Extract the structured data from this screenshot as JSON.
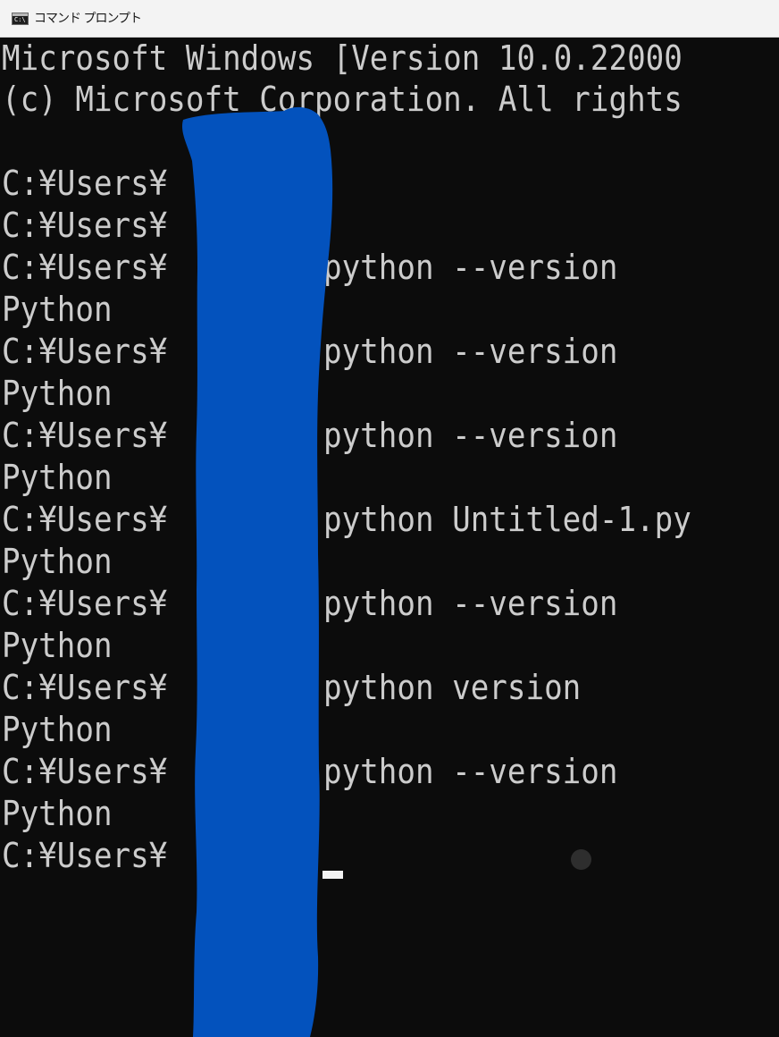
{
  "window": {
    "title": "コマンド プロンプト",
    "icon": "command-prompt-icon",
    "icon_glyph": "C:\\"
  },
  "console": {
    "banner": [
      "Microsoft Windows [Version 10.0.22000",
      "(c) Microsoft Corporation. All rights"
    ],
    "history": [
      {
        "prompt": "C:¥Users¥",
        "command": ""
      },
      {
        "prompt": "C:¥Users¥",
        "command": ""
      },
      {
        "prompt": "C:¥Users¥",
        "command": "python --version",
        "output": "Python"
      },
      {
        "prompt": "C:¥Users¥",
        "command": "python --version",
        "output": "Python"
      },
      {
        "prompt": "C:¥Users¥",
        "command": "python --version",
        "output": "Python"
      },
      {
        "prompt": "C:¥Users¥",
        "command": "python Untitled-1.py",
        "output": "Python"
      },
      {
        "prompt": "C:¥Users¥",
        "command": "python --version",
        "output": "Python"
      },
      {
        "prompt": "C:¥Users¥",
        "command": "python version",
        "output": "Python"
      },
      {
        "prompt": "C:¥Users¥",
        "command": "python --version",
        "output": "Python"
      }
    ],
    "current_prompt": "C:¥Users¥",
    "colors": {
      "background": "#0c0c0c",
      "text": "#cccccc",
      "redaction": "#0352bd"
    }
  }
}
